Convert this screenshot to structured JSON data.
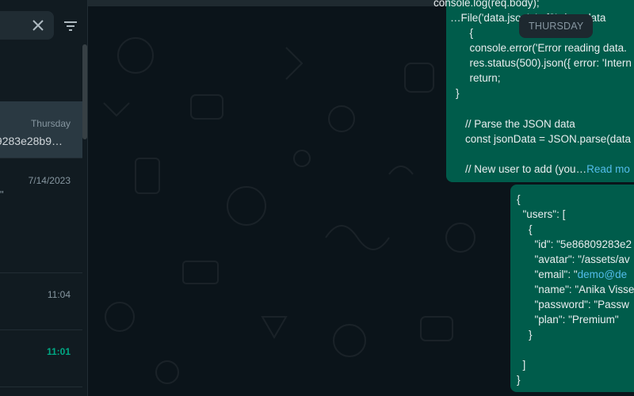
{
  "sidebar": {
    "search_value": "",
    "chats": [
      {
        "time": "Thursday",
        "preview": "9283e28b9…",
        "active": true
      },
      {
        "time": "7/14/2023",
        "preview": "\"",
        "active": false
      },
      {
        "time": "11:04",
        "active": false
      },
      {
        "time": "11:01",
        "unread": true,
        "active": false
      }
    ]
  },
  "chat": {
    "date_divider": "THURSDAY",
    "message1": {
      "lines": [
        "console.log(req.body);",
        "…File('data.json', 'utf8', (err, data",
        "  {",
        "  console.error('Error reading data.",
        "  res.status(500).json({ error: 'Intern",
        "  return;",
        "}",
        "",
        "// Parse the JSON data",
        "const jsonData = JSON.parse(data",
        "",
        "// New user to add (you…"
      ],
      "read_more": "Read mo"
    },
    "message2": {
      "lines": [
        "{",
        "  \"users\": [",
        "    {",
        "      \"id\": \"5e86809283e2",
        "      \"avatar\": \"/assets/av",
        "      \"email\": \"",
        "      \"name\": \"Anika Visse",
        "      \"password\": \"Passw",
        "      \"plan\": \"Premium\"",
        "    }",
        "",
        "  ]",
        "}"
      ],
      "email_link": "demo@de"
    }
  },
  "colors": {
    "bubble_out": "#005c4b",
    "panel": "#111b21",
    "active_chat": "#2a3942",
    "accent": "#00a884",
    "link": "#53bdeb"
  }
}
